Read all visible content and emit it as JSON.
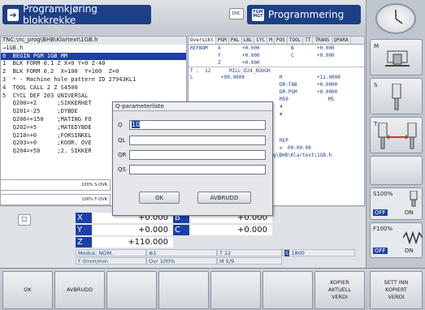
{
  "header": {
    "mode_left": "Programkjøring blokkrekke",
    "dnc_label": "DNC",
    "mode_right": "Programmering",
    "mode_right_icon": "FGM MGT"
  },
  "program": {
    "path": "TNC:\\nc_prog\\BHB\\Klartext\\1GB.h",
    "lines": [
      "→1GB.h",
      "0  BEGIN PGM 1GB MM",
      "1  BLK FORM 0.1 Z X+0 Y+0 Z-40",
      "2  BLK FORM 0.2  X+100  Y+100  Z+0",
      "3  * - Machine hole pattern ID 27943KL1",
      "4  TOOL CALL 2 Z S4500",
      "5  CYCL DEF 203 UNIVERSAL",
      "   Q200=+2      ;SIKKERHET",
      "   Q201=-25     ;DYBDE",
      "   Q206=+150    ;MATING FO",
      "   Q202=+5      ;MATEDYBDE",
      "   Q210=+0      ;FORSINKEL",
      "   Q203=+0      ;KOOR. OVE",
      "   Q204=+50     ;2. SIKKER"
    ]
  },
  "status": {
    "tabs": [
      "Oversikt",
      "PGM",
      "PAL",
      "LBL",
      "CYC",
      "M",
      "POS",
      "TOOL",
      "TT",
      "TRANS",
      "QPARA"
    ],
    "refnom": "REFNOM",
    "x_label": "X",
    "x_val": "+0.000",
    "y_label": "Y",
    "y_val": "+0.000",
    "z_label": "Z",
    "z_val": "+0.000",
    "b_label": "B",
    "b_val": "+0.000",
    "c_label": "C",
    "c_val": "+0.000",
    "t_label": "T :",
    "t_num": "12",
    "t_name": "MILL_D24_ROUGH",
    "l_label": "L",
    "l_val": "+90.0000",
    "r_label": "R",
    "r_val": "+12.0000",
    "drtab_label": "DR-TAB",
    "drtab_val": "+0.0000",
    "drpgm_label": "DR-PGM",
    "drpgm_val": "+0.0000",
    "m50": "M50",
    "m5": "M5",
    "rep": "REP",
    "timer": "00:00:00",
    "path2": "g\\BHB\\Klartext\\1GB.h"
  },
  "overrides": {
    "s_ovr": "100% S-OVR",
    "f_ovr": "100% F-OVR"
  },
  "dialog": {
    "title": "Q-parameterliste",
    "q_label": "Q",
    "q_value": "10",
    "ql_label": "QL",
    "qr_label": "QR",
    "qs_label": "QS",
    "ok": "OK",
    "cancel": "AVBRUDD"
  },
  "positions": {
    "x": {
      "axis": "X",
      "value": "+0.000"
    },
    "b": {
      "axis": "B",
      "value": "+0.000"
    },
    "y": {
      "axis": "Y",
      "value": "+0.000"
    },
    "c": {
      "axis": "C",
      "value": "+0.000"
    },
    "z": {
      "axis": "Z",
      "value": "+110.000"
    },
    "modus": "Modus: NOM.",
    "tool_no": "1",
    "t_field": "T 12",
    "s_badge": "S",
    "s_field": "1800",
    "f_field": "F 0mm/min",
    "ovr": "Ovr 100%",
    "m_field": "M 5/9"
  },
  "right_panel": {
    "m_label": "M",
    "s_label": "S",
    "t_label": "T",
    "s100": "S100%",
    "f100": "F100%",
    "off": "OFF",
    "on": "ON"
  },
  "softkeys": {
    "ok": "OK",
    "cancel": "AVBRUDD",
    "copy": "KOPIER\nAKTUELL\nVERDI",
    "paste": "SETT INN\nKOPIERT\nVERDI"
  }
}
